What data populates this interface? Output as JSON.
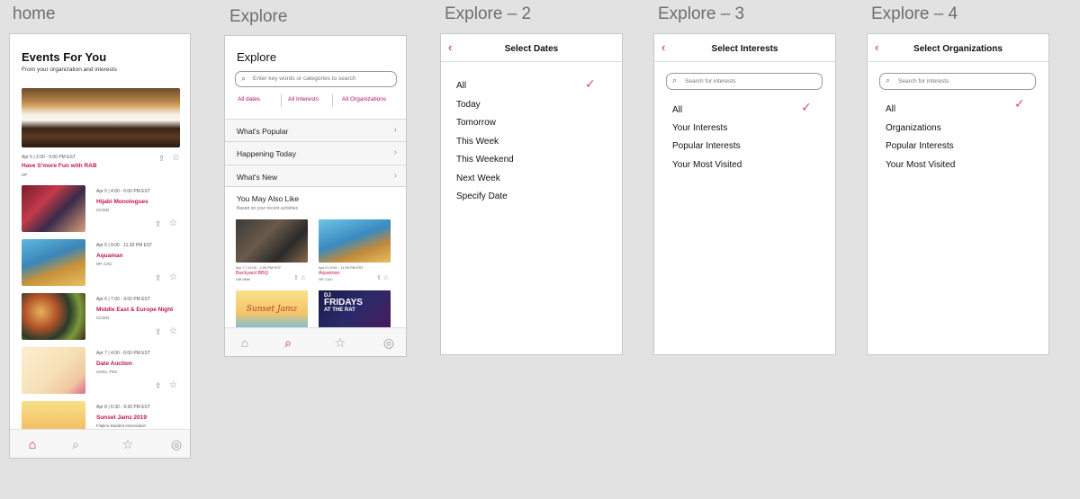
{
  "labels": {
    "home": "home",
    "explore": "Explore",
    "explore2": "Explore – 2",
    "explore3": "Explore – 3",
    "explore4": "Explore – 4"
  },
  "home": {
    "title": "Events For You",
    "subtitle": "From your organization and interests",
    "hero": {
      "date": "Apr 5  |  2:00 - 5:00 PM EST",
      "title": "Have S'more Fun with RAB",
      "org": "HP"
    },
    "events": [
      {
        "date": "Apr 5  |  4:00 - 6:00 PM EST",
        "title": "Hijabi Monologues",
        "org": "CCISO"
      },
      {
        "date": "Apr 5  |  9:00 - 11:30 PM EST",
        "title": "Aquaman",
        "org": "HP, CAC"
      },
      {
        "date": "Apr 6  |  7:00 - 9:00 PM EST",
        "title": "Middle East & Europe Night",
        "org": "CCISO"
      },
      {
        "date": "Apr 7  |  4:00 - 6:00 PM EST",
        "title": "Date Auction",
        "org": "AASA, FSA"
      },
      {
        "date": "Apr 8  |  6:30 - 9:30 PM EST",
        "title": "Sunset Jamz 2019",
        "org": "Filipino Student Association"
      }
    ]
  },
  "explore": {
    "title": "Explore",
    "search_placeholder": "Enter key words or categories to search",
    "filters": [
      "All dates",
      "All Interests",
      "All Organizations"
    ],
    "sections": [
      "What's Popular",
      "Happening Today",
      "What's New"
    ],
    "ymal_title": "You May Also Like",
    "ymal_sub": "Based on your recent activities",
    "cards": [
      {
        "date": "Apr 7  |  12:00 - 2:00 PM EST",
        "title": "Backyard BBQ",
        "org": "UM Hillel"
      },
      {
        "date": "Apr 5  |  9:00 - 11:30 PM EST",
        "title": "Aquaman",
        "org": "HP, CAC"
      }
    ],
    "card3_text": "Sunset Jamz",
    "card4_text_1": "DJ",
    "card4_text_2": "FRIDAYS",
    "card4_text_3": "AT THE RAT"
  },
  "explore2": {
    "title": "Select Dates",
    "options": [
      "All",
      "Today",
      "Tomorrow",
      "This Week",
      "This Weekend",
      "Next Week",
      "Specify Date"
    ]
  },
  "explore3": {
    "title": "Select Interests",
    "search_placeholder": "Search for interests",
    "options": [
      "All",
      "Your Interests",
      "Popular Interests",
      "Your Most Visited"
    ]
  },
  "explore4": {
    "title": "Select Organizations",
    "search_placeholder": "Search for interests",
    "options": [
      "All",
      "Organizations",
      "Popular Interests",
      "Your Most Visited"
    ]
  },
  "icons": {
    "home": "home-icon",
    "search": "search-icon",
    "star": "star-icon",
    "profile": "profile-icon"
  },
  "colors": {
    "accent": "#b0126f",
    "event_title": "#c4154a",
    "check": "#e0457b"
  }
}
